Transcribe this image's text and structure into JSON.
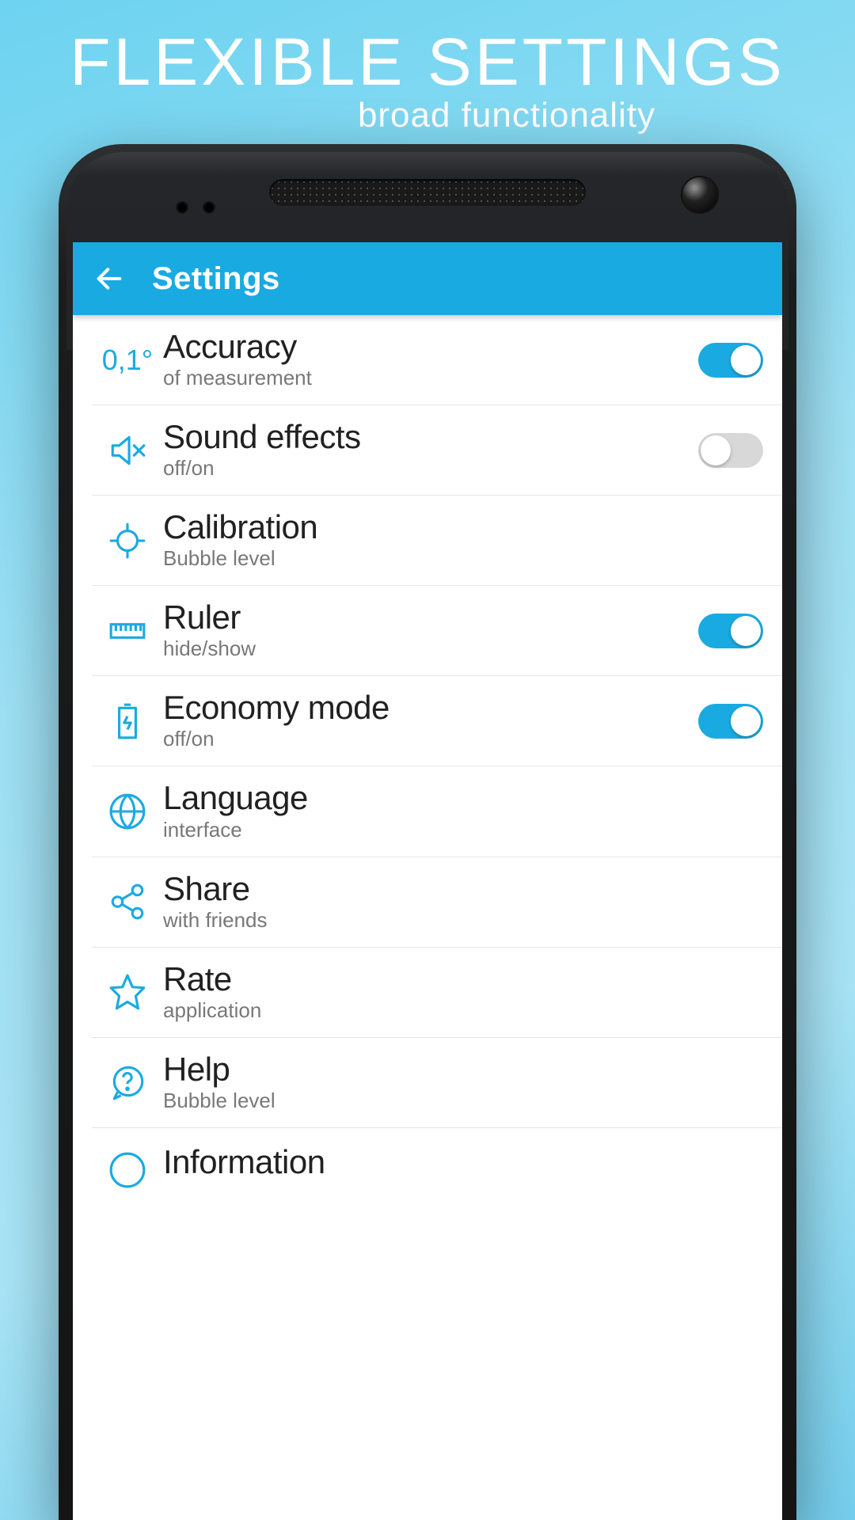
{
  "promo": {
    "title": "FLEXIBLE SETTINGS",
    "subtitle": "broad functionality"
  },
  "app": {
    "header": {
      "title": "Settings"
    },
    "accent": "#1aaae2",
    "settings": [
      {
        "id": "accuracy",
        "icon": "text",
        "icon_text": "0,1°",
        "title": "Accuracy",
        "subtitle": "of measurement",
        "toggle": true
      },
      {
        "id": "sound",
        "icon": "mute",
        "title": "Sound effects",
        "subtitle": "off/on",
        "toggle": false
      },
      {
        "id": "calibration",
        "icon": "target",
        "title": "Calibration",
        "subtitle": "Bubble level",
        "toggle": null
      },
      {
        "id": "ruler",
        "icon": "ruler",
        "title": "Ruler",
        "subtitle": "hide/show",
        "toggle": true
      },
      {
        "id": "economy",
        "icon": "battery",
        "title": "Economy mode",
        "subtitle": "off/on",
        "toggle": true
      },
      {
        "id": "language",
        "icon": "globe",
        "title": "Language",
        "subtitle": "interface",
        "toggle": null
      },
      {
        "id": "share",
        "icon": "share",
        "title": "Share",
        "subtitle": "with friends",
        "toggle": null
      },
      {
        "id": "rate",
        "icon": "star",
        "title": "Rate",
        "subtitle": "application",
        "toggle": null
      },
      {
        "id": "help",
        "icon": "help",
        "title": "Help",
        "subtitle": "Bubble level",
        "toggle": null
      },
      {
        "id": "info",
        "icon": "info",
        "title": "Information",
        "subtitle": "",
        "toggle": null,
        "partial": true
      }
    ]
  }
}
